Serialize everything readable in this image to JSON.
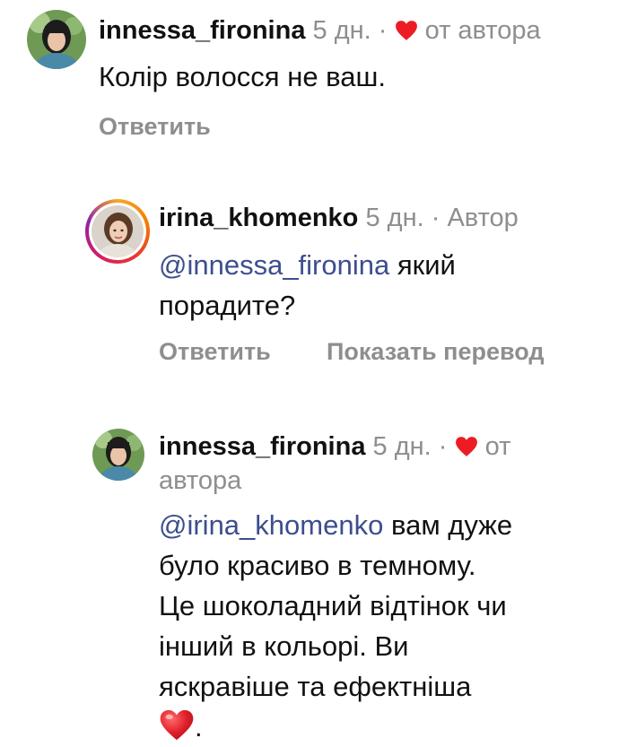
{
  "comments": [
    {
      "username": "innessa_fironina",
      "time": "5 дн.",
      "separator": "·",
      "badge": "от автора",
      "text": "Колір волосся не ваш.",
      "reply_label": "Ответить"
    },
    {
      "username": "irina_khomenko",
      "time": "5 дн.",
      "separator": "·",
      "badge": "Автор",
      "mention": "@innessa_fironina",
      "text_line1": "який",
      "text_line2": "порадите?",
      "reply_label": "Ответить",
      "translate_label": "Показать перевод"
    },
    {
      "username": "innessa_fironina",
      "time": "5 дн.",
      "separator": "·",
      "badge_line1": "от",
      "badge_line2": "автора",
      "mention": "@irina_khomenko",
      "text_line1": "вам дуже",
      "text_line2": "було красиво в темному.",
      "text_line3": "Це шоколадний відтінок чи",
      "text_line4": "інший в кольорі. Ви",
      "text_line5": "яскравіше та ефектніша",
      "text_end": "."
    }
  ],
  "colors": {
    "heart": "#ed1c24",
    "meta": "#8e8e8e",
    "mention": "#3d4e8f"
  }
}
